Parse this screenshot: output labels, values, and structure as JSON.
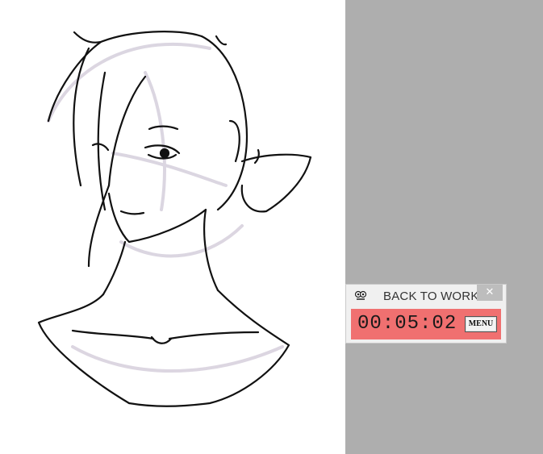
{
  "timer": {
    "title": "BACK TO WORK",
    "close_glyph": "✕",
    "display": "00:05:02",
    "menu_label": "MENU",
    "icon": "owl-icon",
    "body_color": "#f07070"
  },
  "background": {
    "gray_color": "#aeaeae",
    "sketch": "sketch-illustration"
  }
}
